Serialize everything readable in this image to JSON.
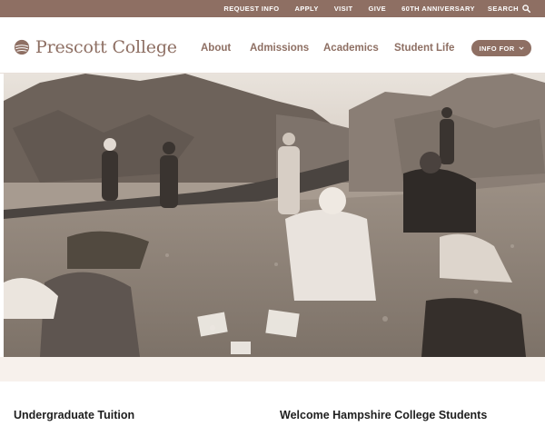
{
  "utility_bar": {
    "links": [
      "REQUEST INFO",
      "APPLY",
      "VISIT",
      "GIVE",
      "60TH ANNIVERSARY"
    ],
    "search_label": "SEARCH",
    "icon": "search-icon"
  },
  "header": {
    "logo_text": "Prescott College",
    "logo_icon": "prescott-logo-mark",
    "nav": [
      "About",
      "Admissions",
      "Academics",
      "Student Life"
    ],
    "info_button": "INFO FOR",
    "info_icon": "chevron-down-icon"
  },
  "hero": {
    "image": "field-class-photo"
  },
  "content": {
    "left_heading": "Undergraduate Tuition",
    "right_heading": "Welcome Hampshire College Students"
  },
  "colors": {
    "brand": "#8e6f63",
    "band": "#f7f1ec"
  }
}
